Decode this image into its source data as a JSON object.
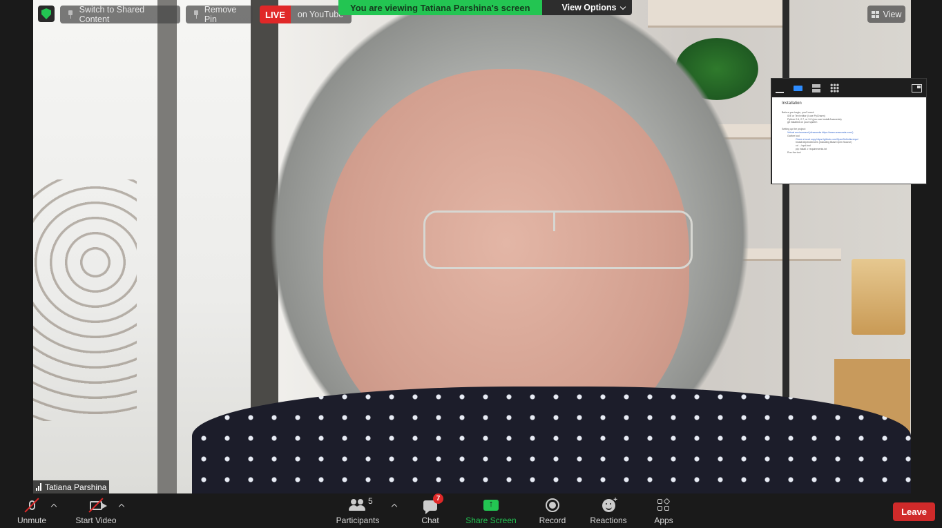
{
  "top_bar": {
    "switch_label": "Switch to Shared Content",
    "remove_pin_label": "Remove Pin",
    "live_badge": "LIVE",
    "live_platform": "on YouTube",
    "viewing_banner": "You are viewing Tatiana Parshina's screen",
    "view_options_label": "View Options",
    "view_label": "View"
  },
  "shared_screen_thumbnail": {
    "title": "Installation",
    "lines": [
      "Before you begin, you'll need:",
      "IDE or Text editor (I use PyCharm)",
      "Python 2.6, 2.7, or 3.0 (you can install Anaconda)",
      "git installed on your system",
      "Setting up the project:",
      "Virtual environment (Anaconda https://www.anaconda.com/)",
      "Gather tool",
      "Clone a local copy https://github.com/OpenDefinition/opd",
      "Install dependencies (including Blast Open Source)",
      "cd .../opd-tool",
      "pip install -r requirements.txt",
      "Run the tool"
    ]
  },
  "participant": {
    "name": "Tatiana Parshina"
  },
  "toolbar": {
    "unmute_label": "Unmute",
    "start_video_label": "Start Video",
    "participants_label": "Participants",
    "participants_count": "5",
    "chat_label": "Chat",
    "chat_badge": "7",
    "share_screen_label": "Share Screen",
    "record_label": "Record",
    "reactions_label": "Reactions",
    "apps_label": "Apps",
    "leave_label": "Leave"
  },
  "colors": {
    "accent_green": "#23c552",
    "live_red": "#e02828",
    "leave_red": "#d02a2a",
    "active_blue": "#2d8cff"
  },
  "icons": [
    "shield-icon",
    "pin-icon",
    "chevron-down-icon",
    "grid-icon",
    "microphone-muted-icon",
    "camera-off-icon",
    "participants-icon",
    "chat-icon",
    "share-screen-icon",
    "record-icon",
    "reactions-icon",
    "apps-icon"
  ]
}
